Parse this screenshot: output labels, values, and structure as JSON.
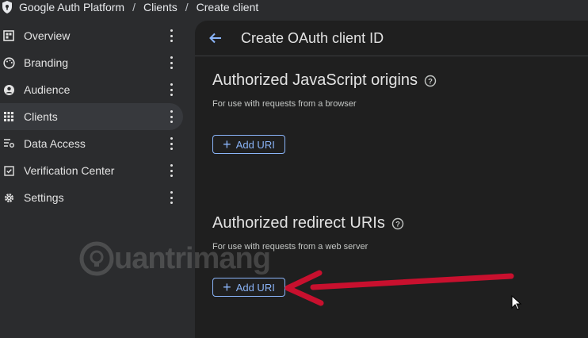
{
  "breadcrumb": {
    "platform": "Google Auth Platform",
    "clients": "Clients",
    "current": "Create client",
    "separator": "/"
  },
  "sidebar": {
    "items": [
      {
        "label": "Overview",
        "icon": "grid-icon"
      },
      {
        "label": "Branding",
        "icon": "palette-icon"
      },
      {
        "label": "Audience",
        "icon": "person-icon"
      },
      {
        "label": "Clients",
        "icon": "apps-icon",
        "active": true
      },
      {
        "label": "Data Access",
        "icon": "tune-list-icon"
      },
      {
        "label": "Verification Center",
        "icon": "verified-icon"
      },
      {
        "label": "Settings",
        "icon": "gear-icon"
      }
    ]
  },
  "panel": {
    "title": "Create OAuth client ID",
    "js_origins": {
      "title": "Authorized JavaScript origins",
      "subtitle": "For use with requests from a browser",
      "button": "Add URI"
    },
    "redirect_uris": {
      "title": "Authorized redirect URIs",
      "subtitle": "For use with requests from a web server",
      "button": "Add URI"
    }
  },
  "watermark": "uantrimang",
  "colors": {
    "accent": "#8ab4f8",
    "annotation_arrow": "#c8102e",
    "panel_bg": "#1f1f1f",
    "page_bg": "#2b2c2e"
  }
}
